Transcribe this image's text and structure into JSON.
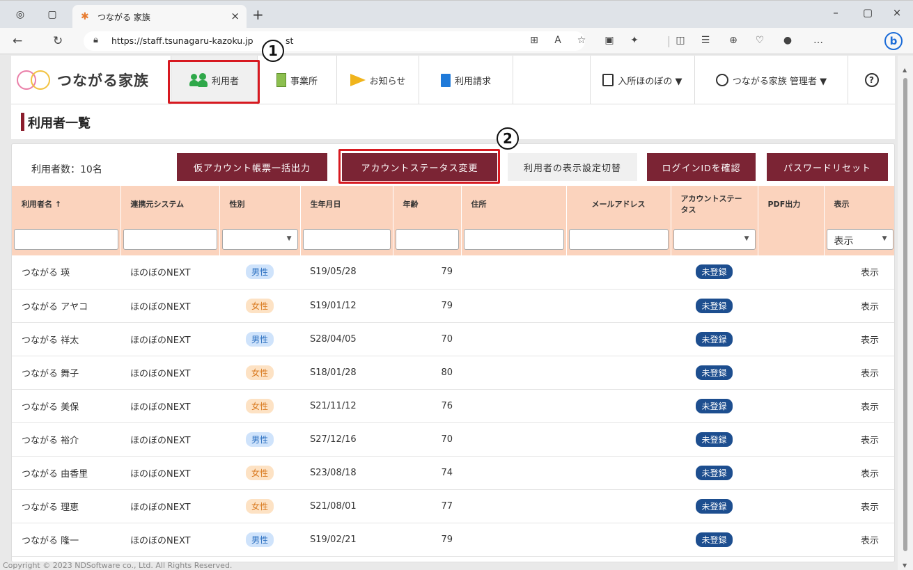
{
  "browser": {
    "tab_title": "つながる 家族",
    "tab_close": "×",
    "new_tab": "+",
    "url": "https://staff.tsunagaru-kazoku.jp",
    "url_tail": "st",
    "window": {
      "minimize": "–",
      "maximize": "▢",
      "close": "×"
    }
  },
  "app": {
    "logo_text": "つながる家族",
    "nav": {
      "users": "利用者",
      "offices": "事業所",
      "notices": "お知らせ",
      "billing": "利用請求",
      "facility": "入所ほのぼの ▼",
      "account": "つながる家族 管理者 ▼",
      "help": "?"
    },
    "callouts": {
      "one": "1",
      "two": "2"
    }
  },
  "page": {
    "title": "利用者一覧",
    "count": "利用者数：10名",
    "buttons": {
      "temp_account_output": "仮アカウント帳票一括出力",
      "account_status_change": "アカウントステータス変更",
      "display_toggle": "利用者の表示設定切替",
      "check_login": "ログインIDを確認",
      "password_reset": "パスワードリセット"
    },
    "columns": {
      "name": "利用者名 ↑",
      "system": "連携元システム",
      "gender": "性別",
      "birth": "生年月日",
      "age": "年齢",
      "address": "住所",
      "email": "メールアドレス",
      "status": "アカウントステータス",
      "pdf": "PDF出力",
      "display": "表示"
    },
    "filter_display_value": "表示",
    "rows": [
      {
        "name": "つながる 瑛",
        "system": "ほのぼのNEXT",
        "gender": "男性",
        "gtype": "male",
        "birth": "S19/05/28",
        "age": "79",
        "status": "未登録",
        "display": "表示"
      },
      {
        "name": "つながる アヤコ",
        "system": "ほのぼのNEXT",
        "gender": "女性",
        "gtype": "female",
        "birth": "S19/01/12",
        "age": "79",
        "status": "未登録",
        "display": "表示"
      },
      {
        "name": "つながる 祥太",
        "system": "ほのぼのNEXT",
        "gender": "男性",
        "gtype": "male",
        "birth": "S28/04/05",
        "age": "70",
        "status": "未登録",
        "display": "表示"
      },
      {
        "name": "つながる 舞子",
        "system": "ほのぼのNEXT",
        "gender": "女性",
        "gtype": "female",
        "birth": "S18/01/28",
        "age": "80",
        "status": "未登録",
        "display": "表示"
      },
      {
        "name": "つながる 美保",
        "system": "ほのぼのNEXT",
        "gender": "女性",
        "gtype": "female",
        "birth": "S21/11/12",
        "age": "76",
        "status": "未登録",
        "display": "表示"
      },
      {
        "name": "つながる 裕介",
        "system": "ほのぼのNEXT",
        "gender": "男性",
        "gtype": "male",
        "birth": "S27/12/16",
        "age": "70",
        "status": "未登録",
        "display": "表示"
      },
      {
        "name": "つながる 由香里",
        "system": "ほのぼのNEXT",
        "gender": "女性",
        "gtype": "female",
        "birth": "S23/08/18",
        "age": "74",
        "status": "未登録",
        "display": "表示"
      },
      {
        "name": "つながる 理恵",
        "system": "ほのぼのNEXT",
        "gender": "女性",
        "gtype": "female",
        "birth": "S21/08/01",
        "age": "77",
        "status": "未登録",
        "display": "表示"
      },
      {
        "name": "つながる 隆一",
        "system": "ほのぼのNEXT",
        "gender": "男性",
        "gtype": "male",
        "birth": "S19/02/21",
        "age": "79",
        "status": "未登録",
        "display": "表示"
      }
    ]
  },
  "footer": "Copyright © 2023 NDSoftware co., Ltd. All Rights Reserved.",
  "colors": {
    "accent": "#7b2434",
    "header_bg": "#fbd3bd",
    "status_badge": "#1d4e8f",
    "highlight": "#d71920"
  }
}
